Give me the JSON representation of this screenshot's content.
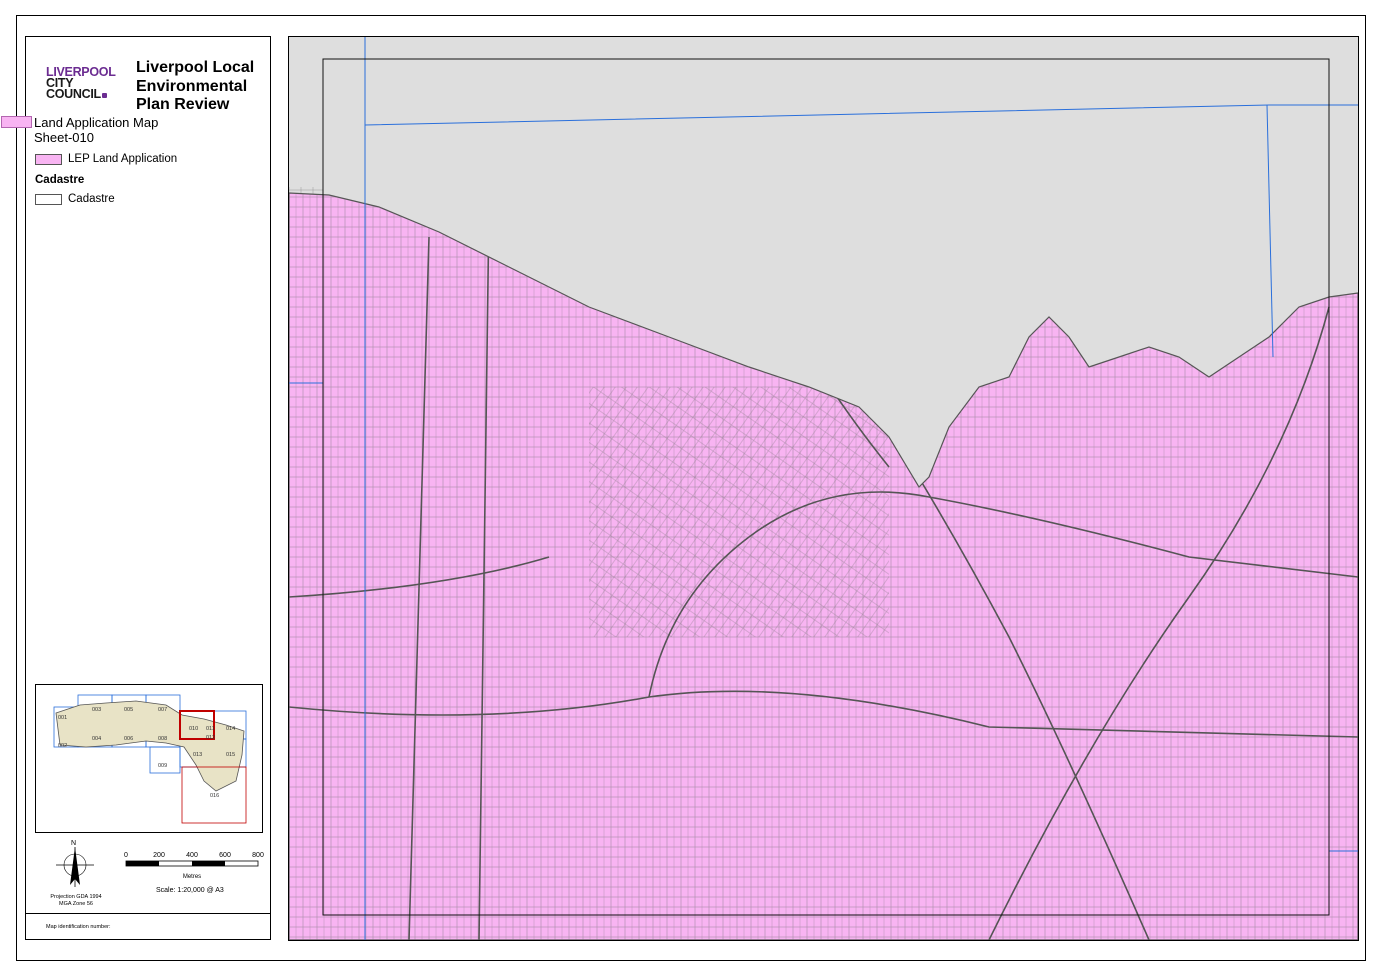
{
  "council": {
    "line1": "LIVERPOOL",
    "line2": "CITY",
    "line3": "COUNCIL",
    "brand_color": "#6b2c91"
  },
  "title": {
    "line1": "Liverpool Local",
    "line2": "Environmental",
    "line3": "Plan Review"
  },
  "map_name": "Land Application Map",
  "sheet": "Sheet-010",
  "legend": {
    "land_application_label": "LEP Land Application",
    "land_application_color": "#f8b4f2",
    "cadastre_heading": "Cadastre",
    "cadastre_label": "Cadastre"
  },
  "key_map": {
    "sheets": [
      "001",
      "002",
      "003",
      "004",
      "005",
      "006",
      "007",
      "008",
      "009",
      "010",
      "011",
      "012",
      "013",
      "014",
      "015",
      "016"
    ],
    "current_sheet": "010"
  },
  "north_arrow_label": "N",
  "scale_bar": {
    "ticks": [
      "0",
      "200",
      "400",
      "600",
      "800"
    ],
    "unit": "Metres"
  },
  "projection": {
    "line1": "Projection GDA 1994",
    "line2": "MGA Zone 56"
  },
  "scale_text": "Scale: 1:20,000 @ A3",
  "footer_label": "Map identification number:",
  "colors": {
    "land_fill": "#f8b4f2",
    "outside_fill": "#dedede",
    "parcel_line": "#555555",
    "boundary_line": "#2a6fdb"
  }
}
